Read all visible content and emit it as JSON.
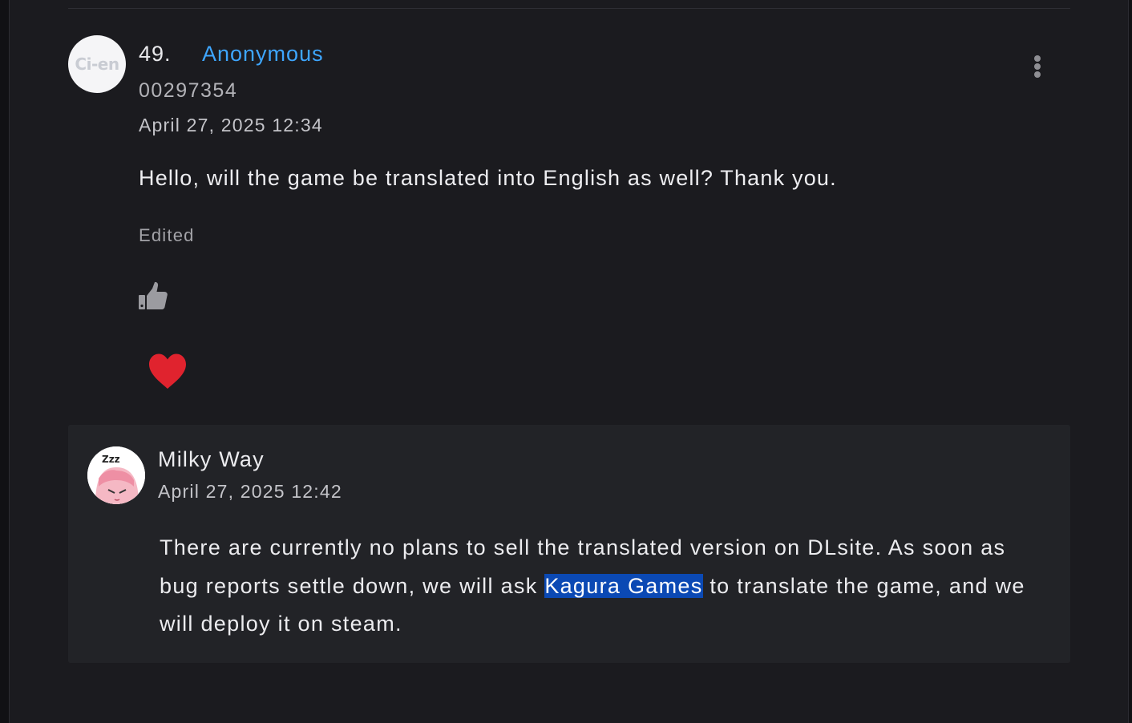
{
  "comment": {
    "avatar_text": "Ci-en",
    "number": "49.",
    "author": "Anonymous",
    "user_id": "00297354",
    "timestamp": "April 27, 2025 12:34",
    "body": "Hello, will the game be translated into English as well? Thank you.",
    "edited_label": "Edited",
    "reactions": {
      "like_icon": "thumbs-up-icon",
      "heart_icon": "heart-icon",
      "heart_color": "#e0232e"
    },
    "menu_icon": "vertical-dots-icon"
  },
  "reply": {
    "author": "Milky Way",
    "timestamp": "April 27, 2025 12:42",
    "body_before": "There are currently no plans to sell the translated version on DLsite. As soon as bug reports settle down, we will ask ",
    "body_highlight": "Kagura Games",
    "body_after": " to translate the game, and we will deploy it on steam."
  },
  "colors": {
    "link": "#3ea6ff",
    "highlight": "#0b49b4",
    "background": "#1b1b1f",
    "reply_background": "#222327"
  }
}
